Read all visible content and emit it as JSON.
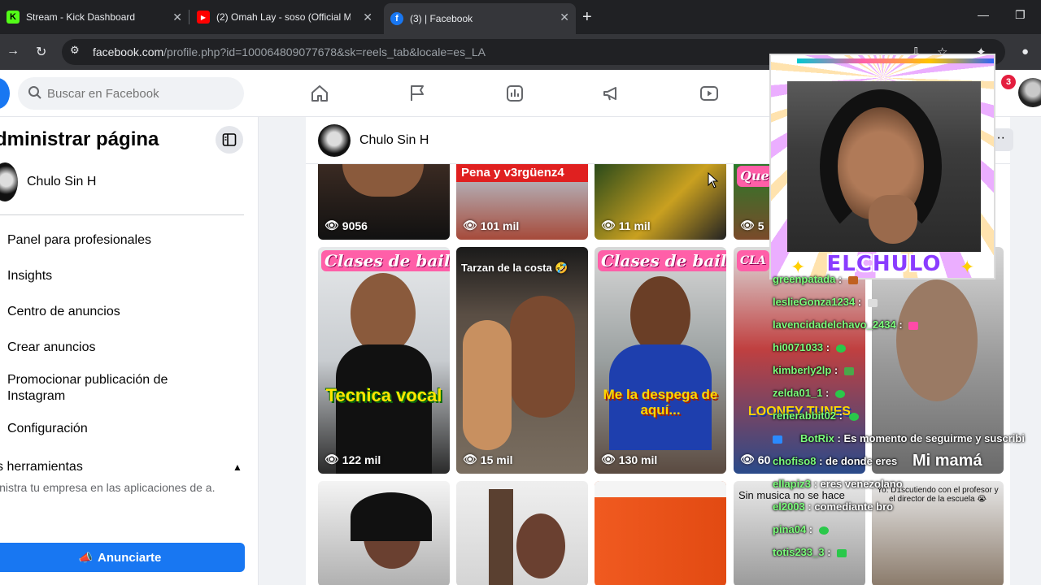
{
  "browser": {
    "tabs": [
      {
        "title": "Stream - Kick Dashboard",
        "icon": "kick-icon",
        "color": "#53fc18"
      },
      {
        "title": "(2) Omah Lay - soso (Official M",
        "icon": "youtube-icon",
        "color": "#ff0000"
      },
      {
        "title": "(3) | Facebook",
        "icon": "facebook-icon",
        "color": "#1877f2"
      }
    ],
    "new_tab": "+",
    "url_host": "facebook.com",
    "url_path": "/profile.php?id=100064809077678&sk=reels_tab&locale=es_LA"
  },
  "fb": {
    "search_placeholder": "Buscar en Facebook",
    "notif_count": "3",
    "accent": "#1877f2"
  },
  "sidebar": {
    "title": "dministrar página",
    "page_name": "Chulo Sin H",
    "items": [
      "Panel para profesionales",
      "Insights",
      "Centro de anuncios",
      "Crear anuncios",
      "Promocionar publicación de Instagram",
      "Configuración"
    ],
    "section_title": "s herramientas",
    "section_desc": "inistra tu empresa en las aplicaciones de a.",
    "cta": "Anunciarte"
  },
  "main": {
    "page_name": "Chulo Sin H",
    "more": "···",
    "reels_row1": [
      {
        "views": "9056"
      },
      {
        "caption": "Pena y v3rgüenz4",
        "views": "101 mil"
      },
      {
        "views": "11 mil"
      },
      {
        "caption": "Que",
        "views": "5"
      }
    ],
    "reels_row2": [
      {
        "banner": "Clases de baile",
        "overlay": "Tecnica vocal",
        "views": "122 mil"
      },
      {
        "caption": "Tarzan de la costa 🤣",
        "views": "15 mil"
      },
      {
        "banner": "Clases de baile",
        "overlay": "Me la despega de aquí...",
        "views": "130 mil"
      },
      {
        "banner": "CLA",
        "overlay": "LOONEY TUNES",
        "views": "60"
      },
      {
        "caption": "Mi mamá"
      }
    ],
    "reels_row3": [
      {},
      {},
      {},
      {
        "caption": "Sin musica no se hace"
      },
      {
        "caption": "Yo: D1scutiendo con el profesor y el director de la escuela 😭"
      }
    ]
  },
  "stream": {
    "streamer": "ELCHULO",
    "chat": [
      {
        "user": "greenpatada",
        "msg": ""
      },
      {
        "user": "leslieGonza1234",
        "msg": ""
      },
      {
        "user": "lavencidadelchavo_2434",
        "msg": ""
      },
      {
        "user": "hi0071033",
        "msg": ""
      },
      {
        "user": "kimberly2lp",
        "msg": ""
      },
      {
        "user": "zelda01_1",
        "msg": ""
      },
      {
        "user": "renerabbit02",
        "msg": ""
      },
      {
        "user": "BotRix",
        "msg": "Es momento de seguirme y suscribi"
      },
      {
        "user": "chofiso8",
        "msg": "de donde eres"
      },
      {
        "user": "ellapiz3",
        "msg": "eres venezolano"
      },
      {
        "user": "el2003",
        "msg": "comediante bro"
      },
      {
        "user": "pina04",
        "msg": ""
      },
      {
        "user": "totis233_3",
        "msg": ""
      }
    ]
  }
}
